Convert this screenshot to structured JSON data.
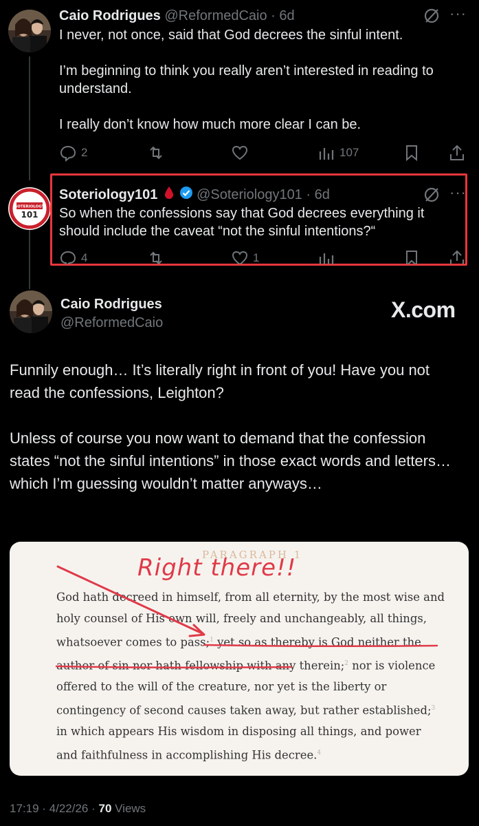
{
  "tweet1": {
    "name": "Caio Rodrigues",
    "handle_time": "@ReformedCaio · 6d",
    "paragraphs": [
      "I never, not once, said that God decrees the sinful intent.",
      "I’m beginning to think you really aren’t interested in reading to understand.",
      "I really don’t know how much more clear I can be."
    ],
    "replies": "2",
    "views": "107"
  },
  "tweet2": {
    "name": "Soteriology101",
    "handle_time": "@Soteriology101 · 6d",
    "text": "So when the confessions say that God decrees everything it should include the caveat “not the sinful intentions?“",
    "replies": "4",
    "likes": "1",
    "avatar_label": "101",
    "avatar_top": "SOTERIOLOGY"
  },
  "main": {
    "name": "Caio Rodrigues",
    "handle": "@ReformedCaio",
    "watermark": "X.com",
    "paragraphs": [
      "Funnily enough… It’s literally right in front of you! Have you not read the confessions, Leighton?",
      "Unless of course you now want to demand that the confession states “not the sinful intentions” in those exact words and letters… which I’m guessing wouldn’t matter anyways…"
    ],
    "footer_time": "17:19 · 4/22/26 · ",
    "footer_views": "70",
    "footer_views_label": " Views"
  },
  "document": {
    "label": "PARAGRAPH 1",
    "annotation": "Right there!!",
    "seg1": "God hath decreed in himself, from all eternity, by the most wise and holy counsel of His own will, freely and unchangeably, all things, whatsoever comes to pass;",
    "sup1": "1",
    "seg2": " yet so as thereby is God neither the author of sin nor hath fellowship with any therein;",
    "sup2": "2",
    "seg3": " nor is violence offered to the will of the creature, nor yet is the liberty or contingency of second causes taken away, but rather established;",
    "sup3": "3",
    "seg4": " in which appears His wisdom in disposing all things, and power and faithfulness in accomplishing His decree.",
    "sup4": "4"
  },
  "colors": {
    "highlight_red": "#e8373b",
    "verified_blue": "#1d9bf0",
    "muted": "#71767b"
  },
  "icons": [
    "grok-icon",
    "more-icon",
    "reply-icon",
    "retweet-icon",
    "like-icon",
    "views-icon",
    "bookmark-icon",
    "share-icon",
    "verified-icon",
    "blood-drop-icon"
  ]
}
